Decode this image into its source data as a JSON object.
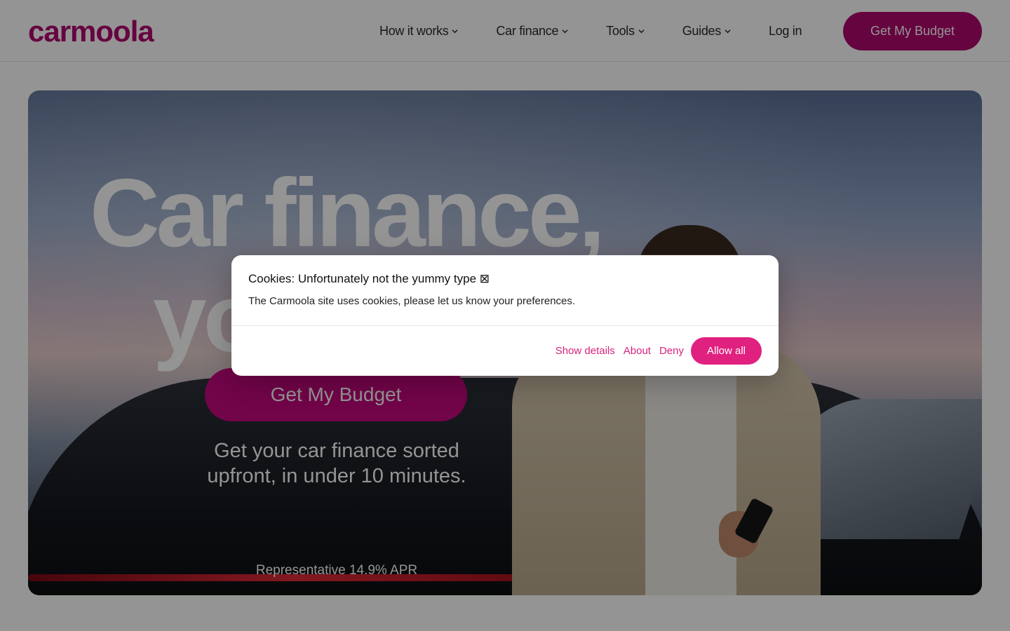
{
  "header": {
    "logo": "carmoola",
    "nav": [
      {
        "label": "How it works"
      },
      {
        "label": "Car finance"
      },
      {
        "label": "Tools"
      },
      {
        "label": "Guides"
      }
    ],
    "login": "Log in",
    "cta": "Get My Budget"
  },
  "hero": {
    "headline_line1": "Car finance,",
    "headline_line2": "yo",
    "cta": "Get My Budget",
    "sub_line1": "Get your car finance sorted",
    "sub_line2": "upfront, in under 10 minutes.",
    "apr": "Representative 14.9% APR"
  },
  "cookie": {
    "title": "Cookies: Unfortunately not the yummy type ⊠",
    "text": "The Carmoola site uses cookies, please let us know your preferences.",
    "show_details": "Show details",
    "about": "About",
    "deny": "Deny",
    "allow_all": "Allow all"
  },
  "colors": {
    "brand": "#b0086e",
    "cookie_accent": "#e0217f"
  }
}
